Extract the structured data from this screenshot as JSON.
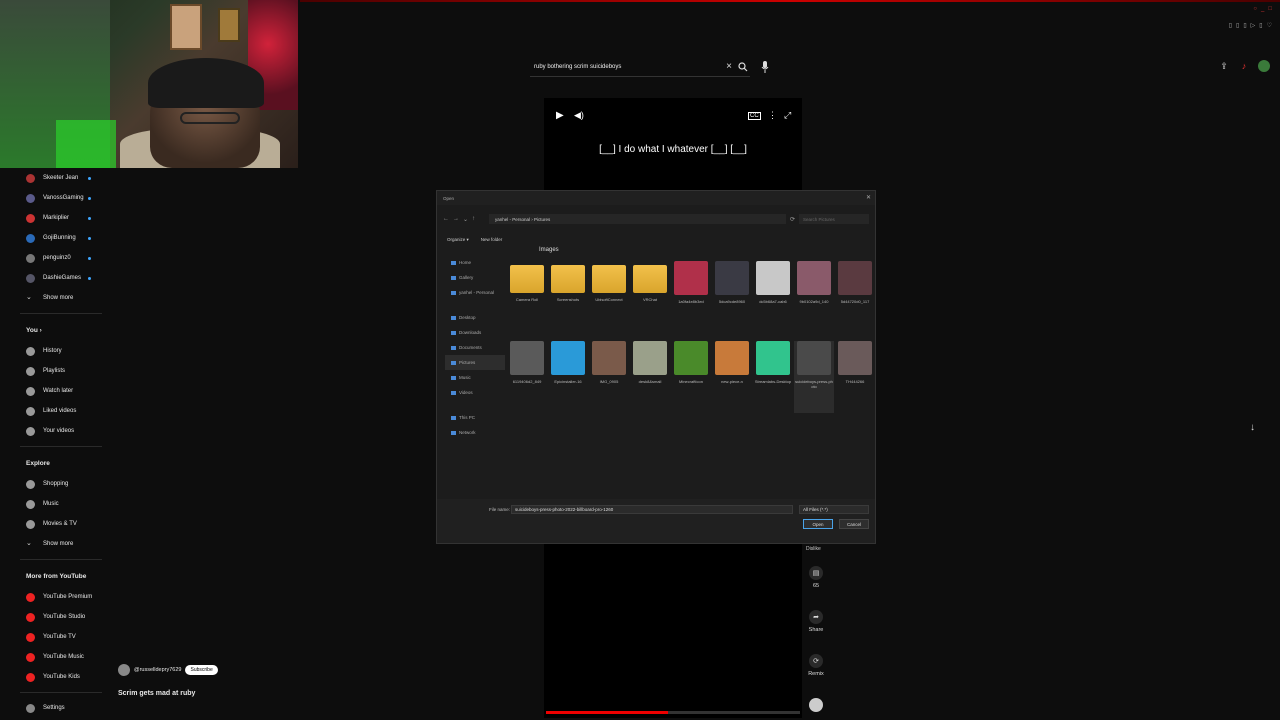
{
  "search": {
    "query": "ruby bothering scrim suicideboys"
  },
  "short": {
    "caption": "[__] I do what I whatever [__] [__]",
    "progress": 0.48
  },
  "sidebar": {
    "subscriptions": [
      "Skeeter Jean",
      "VanossGaming",
      "Markiplier",
      "GojiBunning",
      "penguinz0",
      "DashieGames"
    ],
    "show_more": "Show more",
    "you_header": "You",
    "you_items": [
      "History",
      "Playlists",
      "Watch later",
      "Liked videos",
      "Your videos"
    ],
    "explore_header": "Explore",
    "explore_items": [
      "Shopping",
      "Music",
      "Movies & TV"
    ],
    "explore_more": "Show more",
    "more_header": "More from YouTube",
    "more_items": [
      "YouTube Premium",
      "YouTube Studio",
      "YouTube TV",
      "YouTube Music",
      "YouTube Kids"
    ],
    "settings": "Settings"
  },
  "channel": {
    "handle": "@russelldepry7629",
    "subscribe": "Subscribe"
  },
  "video_title": "Scrim gets mad at ruby",
  "actions": {
    "dislike": "Dislike",
    "comments": "65",
    "share": "Share",
    "remix": "Remix"
  },
  "dialog": {
    "title": "Open",
    "address": "yanhel - Personal › Pictures",
    "search_placeholder": "Search Pictures",
    "organize": "Organize ▾",
    "new_folder": "New folder",
    "section_header": "Images",
    "nav": [
      "Home",
      "Gallery",
      "yanhel - Personal",
      "Desktop",
      "Downloads",
      "Documents",
      "Pictures",
      "Music",
      "Videos",
      "This PC",
      "Network"
    ],
    "files": [
      {
        "name": "Camera Roll",
        "kind": "folder",
        "color": "#f2c14b"
      },
      {
        "name": "Screenshots",
        "kind": "folder",
        "color": "#f2c14b"
      },
      {
        "name": "UbisoftConnect",
        "kind": "folder",
        "color": "#f2c14b"
      },
      {
        "name": "VRChat",
        "kind": "folder",
        "color": "#f2c14b"
      },
      {
        "name": "1a0fa4e8b3ed",
        "kind": "image",
        "color": "#b0304a"
      },
      {
        "name": "5dca9cde8960",
        "kind": "image",
        "color": "#3a3a44"
      },
      {
        "name": "dc5b68a7-cab6",
        "kind": "image",
        "color": "#c8c8c8"
      },
      {
        "name": "9b0102a9d_140",
        "kind": "image",
        "color": "#8a5a6a"
      },
      {
        "name": "5d44720d0_117",
        "kind": "image",
        "color": "#5a3a40"
      },
      {
        "name": "6119406d2_849",
        "kind": "image",
        "color": "#5a5a5a"
      },
      {
        "name": "Epicinstaller-16",
        "kind": "image",
        "color": "#2a9ad8"
      },
      {
        "name": "IMG_0905",
        "kind": "image",
        "color": "#7a5a4a"
      },
      {
        "name": "desk8&small",
        "kind": "image",
        "color": "#9aa08a"
      },
      {
        "name": "MinecraftIcon",
        "kind": "image",
        "color": "#4a8a2a"
      },
      {
        "name": "new-piece-n",
        "kind": "image",
        "color": "#c87a3a"
      },
      {
        "name": "Streamlabs-Desktop",
        "kind": "image",
        "color": "#31c48d"
      },
      {
        "name": "suicideboys-press-photo",
        "kind": "image",
        "color": "#4a4a4a"
      },
      {
        "name": "TH444266",
        "kind": "image",
        "color": "#6a5a5a"
      }
    ],
    "file_name_label": "File name:",
    "file_name": "suicideboys-press-photo-2022-billboard-pro-1260",
    "file_type": "All Files (*.*)",
    "open": "Open",
    "cancel": "Cancel"
  }
}
